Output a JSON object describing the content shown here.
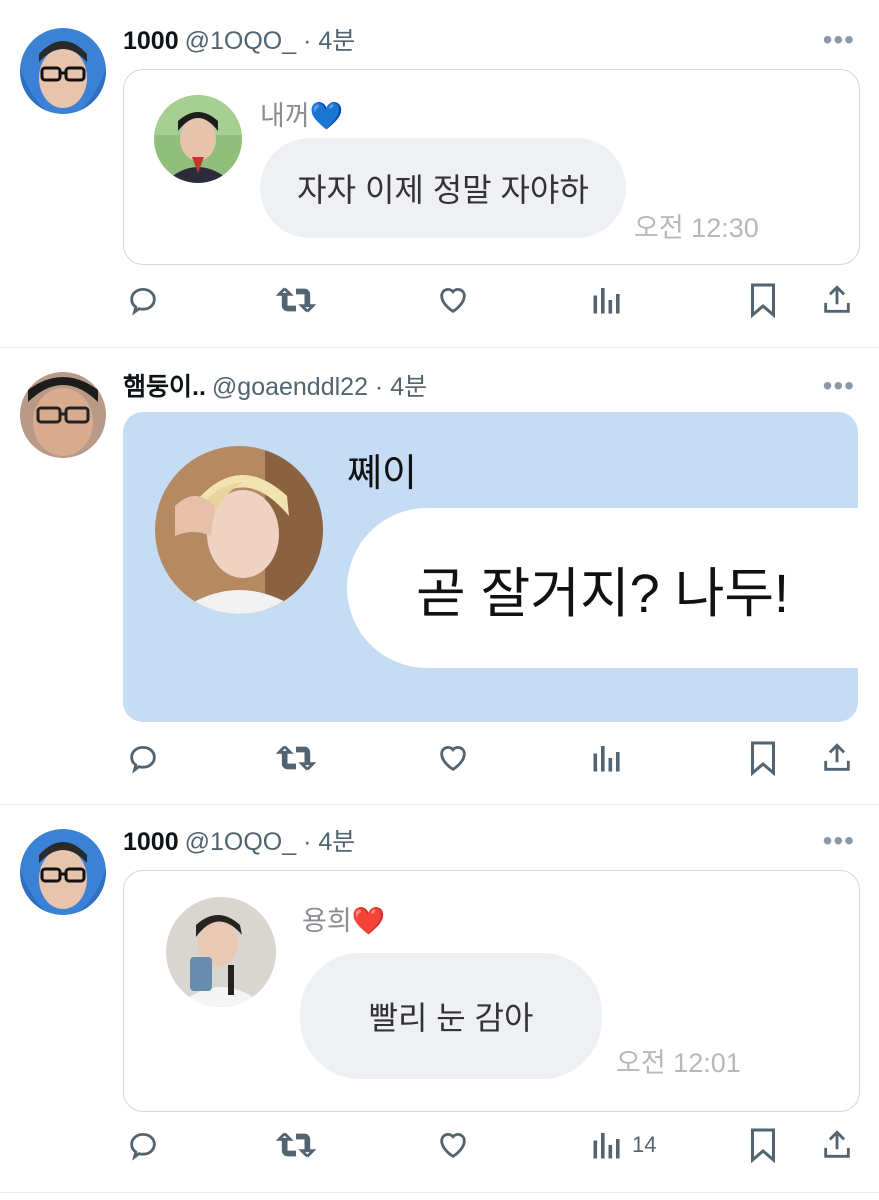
{
  "tweets": [
    {
      "name": "1000",
      "meta": "@1OQO_ · 4분",
      "chat": {
        "sender": "내꺼",
        "sender_emoji": "💙",
        "message": "자자 이제 정말 자야하",
        "time": "오전 12:30"
      },
      "views": ""
    },
    {
      "name": "햄둥이..",
      "meta": "@goaenddl22 · 4분",
      "chat": {
        "sender": "쪠이",
        "sender_emoji": "",
        "message": "곧 잘거지? 나두!",
        "time": ""
      },
      "views": ""
    },
    {
      "name": "1000",
      "meta": "@1OQO_ · 4분",
      "chat": {
        "sender": "용희",
        "sender_emoji": "❤️",
        "message": "빨리 눈 감아",
        "time": "오전 12:01"
      },
      "views": "14"
    }
  ],
  "more_label": "•••",
  "icons": [
    "reply-icon",
    "retweet-icon",
    "like-icon",
    "views-icon",
    "bookmark-icon",
    "share-icon"
  ],
  "colors": {
    "card_blue": "#c6dcf4",
    "bubble_gray": "#eef0f4",
    "icon_gray": "#536471",
    "hoodie_blue": "#3b82d6"
  }
}
